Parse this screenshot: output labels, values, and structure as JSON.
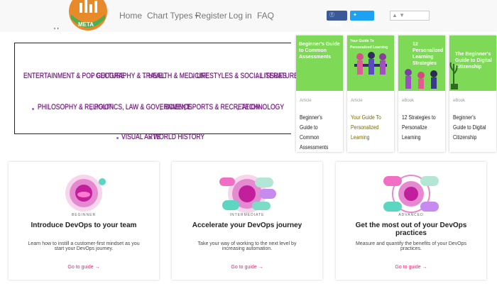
{
  "logo": {
    "text": "META"
  },
  "nav": {
    "home": "Home",
    "chart_types": "Chart Types",
    "register": "Register",
    "login": "Log in",
    "faq": "FAQ"
  },
  "share": {
    "facebook": "Share",
    "twitter": "Tweet"
  },
  "categories": [
    "ENTERTAINMENT & POP CULTURE",
    "GEOGRAPHY & TRAVEL",
    "HEALTH & MEDICINE",
    "LIFESTYLES & SOCIAL ISSUES",
    "LITERATURE",
    "PHILOSOPHY & RELIGION",
    "POLITICS, LAW & GOVERNMENT",
    "SCIENCE",
    "SPORTS & RECREATION",
    "TECHNOLOGY",
    "VISUAL ARTS",
    "WORLD HISTORY"
  ],
  "guides": [
    {
      "thumb_title": "Beginner's Guide to Common Assessments",
      "source": "Article",
      "title": "Beginner's Guide to Common Assessments",
      "highlight": false
    },
    {
      "thumb_title": "Your Guide To Personalized Learning",
      "source": "Article",
      "title": "Your Guide To Personalized Learning",
      "highlight": true
    },
    {
      "thumb_title": "12 Personalized Learning Strategies",
      "source": "eBook",
      "title": "12 Strategies to Personalize Learning",
      "highlight": false
    },
    {
      "thumb_title": "The Beginner's Guide to Digital Citizenship",
      "source": "eBook",
      "title": "Beginner's Guide to Digital Citizenship",
      "highlight": false
    }
  ],
  "devops": [
    {
      "level": "BEGINNER",
      "title": "Introduce DevOps to your team",
      "desc": "Learn how to instill a customer-first mindset as you start your DevOps journey.",
      "link": "Go to guide →"
    },
    {
      "level": "INTERMEDIATE",
      "title": "Accelerate your DevOps journey",
      "desc": "Take your way of working to the next level by increasing automation.",
      "link": "Go to guide →"
    },
    {
      "level": "ADVANCED",
      "title": "Get the most out of your DevOps practices",
      "desc": "Measure and quantify the benefits of your DevOps practices.",
      "link": "Go to guide →"
    }
  ],
  "colors": {
    "accent": "#e0247a",
    "category_text": "#6b1478",
    "guide_thumb": "#7ed957",
    "facebook": "#3b5998",
    "twitter": "#1da1f2"
  }
}
